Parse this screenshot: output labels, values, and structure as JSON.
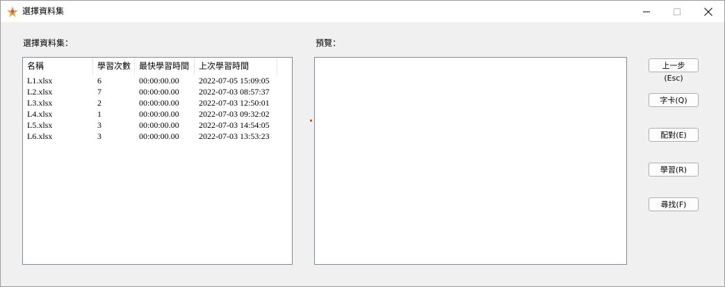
{
  "window": {
    "title": "選擇資料集",
    "icon": "app-logo-icon",
    "controls": [
      "minimize-icon",
      "maximize-icon",
      "close-icon"
    ]
  },
  "labels": {
    "datasets": "選擇資料集：",
    "preview": "預覽："
  },
  "dataset_list": {
    "columns": [
      "名稱",
      "學習次數",
      "最快學習時間",
      "上次學習時間"
    ],
    "rows": [
      [
        "L1.xlsx",
        "6",
        "00:00:00.00",
        "2022-07-05 15:09:05"
      ],
      [
        "L2.xlsx",
        "7",
        "00:00:00.00",
        "2022-07-03 08:57:37"
      ],
      [
        "L3.xlsx",
        "2",
        "00:00:00.00",
        "2022-07-03 12:50:01"
      ],
      [
        "L4.xlsx",
        "1",
        "00:00:00.00",
        "2022-07-03 09:32:02"
      ],
      [
        "L5.xlsx",
        "3",
        "00:00:00.00",
        "2022-07-03 14:54:05"
      ],
      [
        "L6.xlsx",
        "3",
        "00:00:00.00",
        "2022-07-03 13:53:23"
      ]
    ]
  },
  "buttons": {
    "back": "上一步(Esc)",
    "flashcard": "字卡(Q)",
    "match": "配對(E)",
    "learn": "學習(R)",
    "find": "尋找(F)"
  },
  "colors": {
    "window_bg": "#f0f0f0",
    "titlebar_bg": "#ffffff",
    "border": "#828790",
    "marker": "#c0392b"
  }
}
